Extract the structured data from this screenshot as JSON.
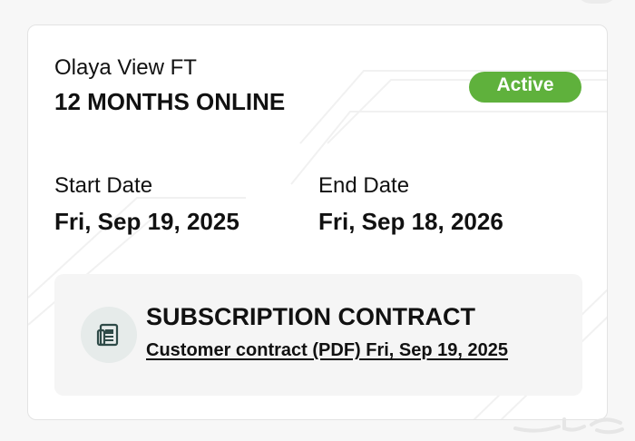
{
  "subscription": {
    "gym_name": "Olaya View FT",
    "plan_name": "12 MONTHS ONLINE",
    "status": "Active",
    "status_color": "#5fb13c",
    "start": {
      "label": "Start Date",
      "value": "Fri, Sep 19, 2025"
    },
    "end": {
      "label": "End Date",
      "value": "Fri, Sep 18, 2026"
    }
  },
  "contract": {
    "icon": "document-icon",
    "title": "SUBSCRIPTION CONTRACT",
    "link_text": "Customer contract (PDF) Fri, Sep 19, 2025",
    "icon_color": "#2e4a47"
  },
  "watermark": "haraj logo"
}
